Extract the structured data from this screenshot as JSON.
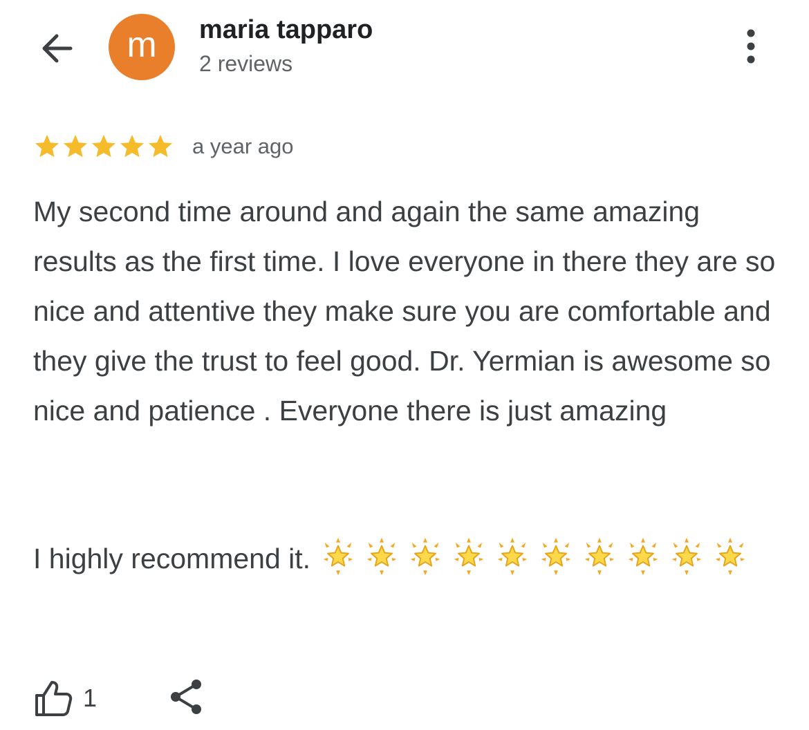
{
  "header": {
    "back_icon": "arrow-back-icon",
    "avatar_letter": "m",
    "avatar_color": "#e97f2b",
    "author_name": "maria tapparo",
    "review_count": "2 reviews",
    "more_icon": "more-vert-icon"
  },
  "review": {
    "rating": 5,
    "rating_max": 5,
    "star_color": "#f6bb2a",
    "time_ago": "a year ago",
    "text": "My second time around and again the same amazing results as the first time. I love everyone in there they are so nice and attentive they make sure you are comfortable and they give the trust to feel good. Dr. Yermian is awesome so nice and patience . Everyone there is just amazing",
    "recommend_text": "I highly recommend it.",
    "emoji_star_count": 10,
    "emoji_star_icon": "glowing-star-emoji"
  },
  "actions": {
    "like_icon": "thumbs-up-icon",
    "like_count": "1",
    "share_icon": "share-icon"
  }
}
